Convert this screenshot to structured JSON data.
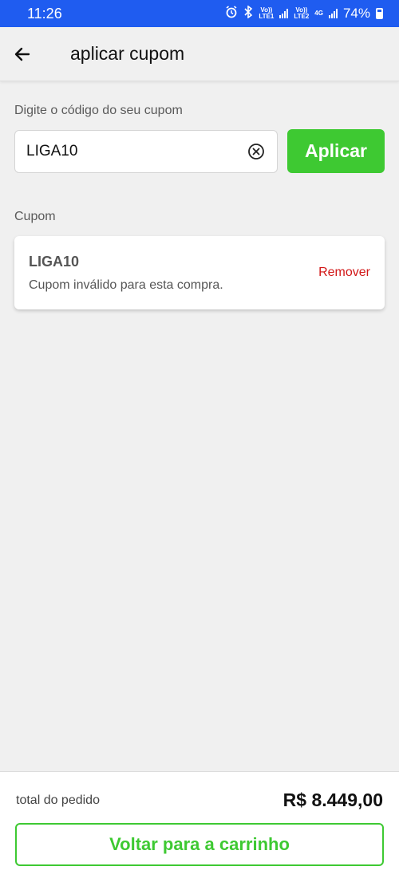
{
  "status_bar": {
    "time": "11:26",
    "sim1_top": "Vo))",
    "sim1_bottom": "LTE1",
    "sim2_top": "Vo))",
    "sim2_bottom": "LTE2",
    "network": "4G",
    "battery": "74%",
    "icons": [
      "alarm-icon",
      "bluetooth-icon",
      "signal-icon",
      "battery-icon"
    ]
  },
  "header": {
    "title": "aplicar cupom",
    "back_icon": "arrow-left-icon"
  },
  "coupon_form": {
    "label": "Digite o código do seu cupom",
    "input_value": "LIGA10",
    "clear_icon": "circle-x-icon",
    "apply_label": "Aplicar"
  },
  "coupon_section": {
    "label": "Cupom",
    "code": "LIGA10",
    "message": "Cupom inválido para esta compra.",
    "remove_label": "Remover"
  },
  "footer": {
    "total_label": "total do pedido",
    "total_value": "R$ 8.449,00",
    "back_label": "Voltar para a carrinho"
  },
  "colors": {
    "status_bar": "#1f5cf0",
    "accent_green": "#3ec932",
    "remove_red": "#d21717",
    "background": "#f0f0f0"
  }
}
